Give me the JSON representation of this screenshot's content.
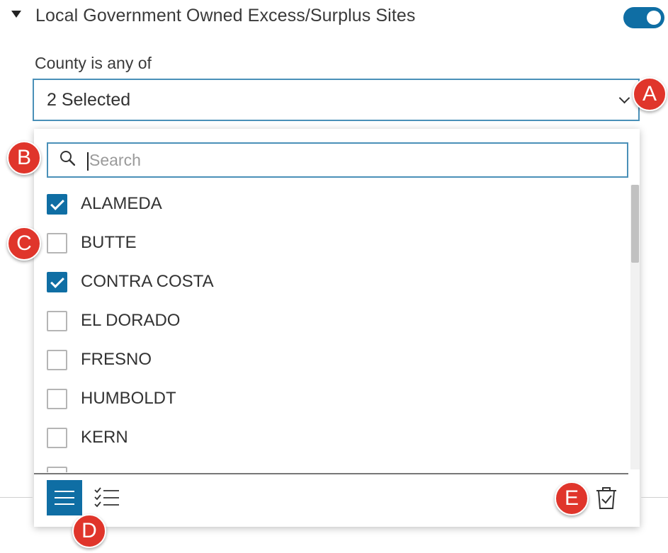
{
  "layer": {
    "title": "Local Government Owned Excess/Surplus Sites",
    "toggle_on": true
  },
  "filter": {
    "label": "County is any of",
    "selected_summary": "2 Selected",
    "search_placeholder": "Search",
    "items": [
      {
        "label": "ALAMEDA",
        "checked": true
      },
      {
        "label": "BUTTE",
        "checked": false
      },
      {
        "label": "CONTRA COSTA",
        "checked": true
      },
      {
        "label": "EL DORADO",
        "checked": false
      },
      {
        "label": "FRESNO",
        "checked": false
      },
      {
        "label": "HUMBOLDT",
        "checked": false
      },
      {
        "label": "KERN",
        "checked": false
      }
    ]
  },
  "badges": {
    "a": "A",
    "b": "B",
    "c": "C",
    "d": "D",
    "e": "E"
  },
  "colors": {
    "accent": "#0f6ea4",
    "badge": "#e0352b"
  },
  "icons": {
    "expand": "caret-down-icon",
    "toggle": "toggle-switch-icon",
    "dropdown": "chevron-down-icon",
    "search": "search-icon",
    "list_view": "list-icon",
    "selected_view": "checklist-icon",
    "clear": "trash-check-icon"
  }
}
